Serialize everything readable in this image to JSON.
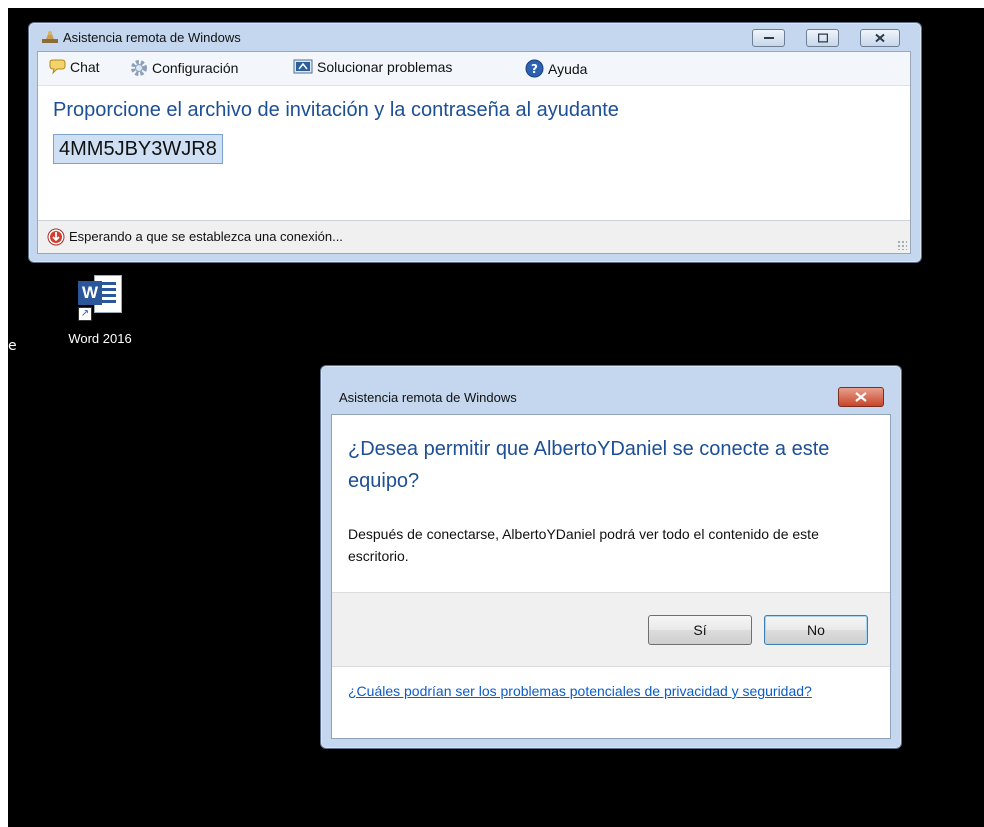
{
  "desktop": {
    "edge_text": "e",
    "icons": [
      {
        "label": "Word 2016",
        "name": "word-2016"
      }
    ]
  },
  "main_window": {
    "title": "Asistencia remota de Windows",
    "toolbar": {
      "chat": "Chat",
      "settings": "Configuración",
      "troubleshoot": "Solucionar problemas",
      "help": "Ayuda"
    },
    "headline": "Proporcione el archivo de invitación y la contraseña al ayudante",
    "password": "4MM5JBY3WJR8",
    "status": "Esperando a que se establezca una conexión..."
  },
  "dialog": {
    "title": "Asistencia remota de Windows",
    "question": "¿Desea permitir que AlbertoYDaniel se conecte a este equipo?",
    "description": "Después de conectarse, AlbertoYDaniel podrá ver todo el contenido de este escritorio.",
    "buttons": {
      "yes": "Sí",
      "no": "No"
    },
    "link": "¿Cuáles podrían ser los problemas potenciales de privacidad y seguridad?"
  },
  "colors": {
    "desktop_background": "#000000",
    "heading_blue": "#1c4f96",
    "link_blue": "#0b5cc7",
    "window_frame": "#c4d7ee",
    "close_red": "#c9452a"
  },
  "icons": [
    "remote-assistance-icon",
    "chat-bubble-icon",
    "gear-icon",
    "troubleshoot-icon",
    "help-icon",
    "status-arrow-icon",
    "word-icon",
    "shortcut-arrow-icon",
    "minimize-icon",
    "maximize-icon",
    "close-icon"
  ]
}
